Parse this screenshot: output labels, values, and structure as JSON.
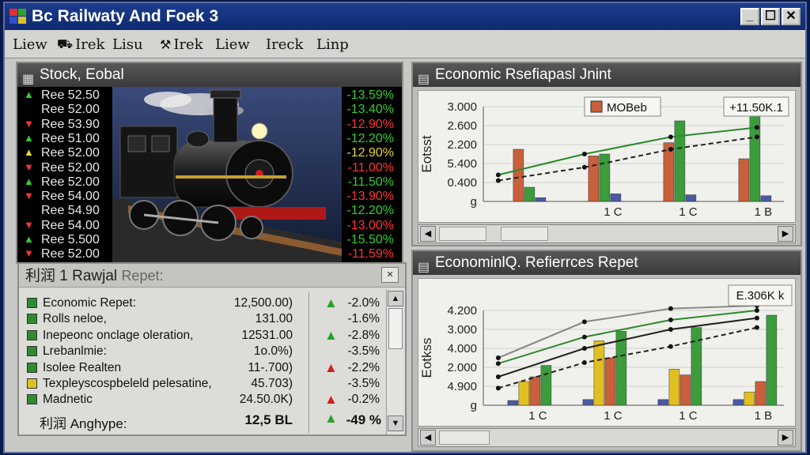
{
  "window": {
    "title": "Bc Railwaty And Foek 3",
    "controls": [
      "_",
      "☐",
      "✕"
    ]
  },
  "menu": [
    {
      "label": "Liew",
      "icon": ""
    },
    {
      "label": "Irek",
      "icon": "⛟"
    },
    {
      "label": "Lisu",
      "icon": ""
    },
    {
      "label": "Irek",
      "icon": "⚒"
    },
    {
      "label": "Liew",
      "icon": ""
    },
    {
      "label": "Ireck",
      "icon": ""
    },
    {
      "label": "Linp",
      "icon": ""
    }
  ],
  "stock_panel": {
    "title": "Stock, Eobal",
    "rows": [
      {
        "label": "Ree 52.50",
        "change": "-13.59%",
        "dir": "up"
      },
      {
        "label": "Ree 52.00",
        "change": "-13.40%",
        "dir": "none"
      },
      {
        "label": "Ree 53.90",
        "change": "-12.90%",
        "dir": "down"
      },
      {
        "label": "Ree 51.00",
        "change": "-12.20%",
        "dir": "up"
      },
      {
        "label": "Ree 52.00",
        "change": "-12.90%",
        "dir": "flat"
      },
      {
        "label": "Ree 52.00",
        "change": "-11.00%",
        "dir": "down"
      },
      {
        "label": "Ree 52.00",
        "change": "-11.50%",
        "dir": "up"
      },
      {
        "label": "Ree 54.00",
        "change": "-13.90%",
        "dir": "down"
      },
      {
        "label": "Ree 54.90",
        "change": "-12.20%",
        "dir": "none"
      },
      {
        "label": "Ree 54.00",
        "change": "-13.00%",
        "dir": "down"
      },
      {
        "label": "Ree 5.500",
        "change": "-15.50%",
        "dir": "up"
      },
      {
        "label": "Ree 52.00",
        "change": "-11.59%",
        "dir": "down"
      }
    ]
  },
  "report_panel": {
    "title": "利润 1 Rawjal",
    "subtitle": "Repet:",
    "close": "×",
    "rows": [
      {
        "name": "Economic Repet:",
        "value": "12,500.00)",
        "dir": "up",
        "pct": "-2.0%",
        "color": "#2e8b2e"
      },
      {
        "name": "Rolls neloe,",
        "value": "131.00",
        "dir": "none",
        "pct": "-1.6%",
        "color": "#2e8b2e"
      },
      {
        "name": "Inepeonc onclage oleration,",
        "value": "12531.00",
        "dir": "up",
        "pct": "-2.8%",
        "color": "#2e8b2e"
      },
      {
        "name": "Lrebanlmie:",
        "value": "1o.0%)",
        "dir": "none",
        "pct": "-3.5%",
        "color": "#2e8b2e"
      },
      {
        "name": "Isolee Realten",
        "value": "11-.700)",
        "dir": "down",
        "pct": "-2.2%",
        "color": "#2e8b2e"
      },
      {
        "name": "Texpleyscospbeleld pelesatine,",
        "value": "45.703)",
        "dir": "none",
        "pct": "-3.5%",
        "color": "#e0c020"
      },
      {
        "name": "Madnetic",
        "value": "24.50.0K)",
        "dir": "down",
        "pct": "-0.2%",
        "color": "#2e8b2e"
      }
    ],
    "total": {
      "label": "利润 Anghype:",
      "value": "12,5 BL",
      "dir": "up",
      "pct": "-49 %"
    }
  },
  "chart_panels": [
    {
      "title": "Economic Rsefiapasl Jnint",
      "legend_label": "MOBeb",
      "legend_color": "#c8603c",
      "badge": "+11.50K.1"
    },
    {
      "title": "EconominlQ. Refierrces Repet",
      "badge": "E.306K k"
    }
  ],
  "chart_data": [
    {
      "type": "bar",
      "ylabel": "Eotsst",
      "y_ticks": [
        "3.000",
        "2.600",
        "2.200",
        "5.400",
        "0.400",
        "g"
      ],
      "categories": [
        "",
        "1 C",
        "1 C",
        "1 B"
      ],
      "series": [
        {
          "name": "MOBeb",
          "color": "#c8603c",
          "values": [
            0.55,
            0.48,
            0.62,
            0.45
          ]
        },
        {
          "color": "#3c9c3c",
          "values": [
            0.15,
            0.5,
            0.85,
            1.0
          ]
        },
        {
          "color": "#4a5aa0",
          "values": [
            0.04,
            0.08,
            0.07,
            0.06
          ]
        }
      ],
      "trend_lines": [
        {
          "color": "#2a8a2a",
          "dash": false,
          "values": [
            0.28,
            0.5,
            0.68,
            0.78
          ]
        },
        {
          "color": "#222222",
          "dash": true,
          "values": [
            0.22,
            0.36,
            0.55,
            0.68
          ]
        }
      ]
    },
    {
      "type": "bar",
      "ylabel": "Eotkss",
      "y_ticks": [
        "4.200",
        "3.000",
        "4.000",
        "2.000",
        "4.900",
        "g"
      ],
      "categories": [
        "1 C",
        "1 C",
        "1 C",
        "1 B"
      ],
      "series": [
        {
          "color": "#4a5aa0",
          "values": [
            0.05,
            0.06,
            0.06,
            0.06
          ]
        },
        {
          "color": "#e0c020",
          "values": [
            0.25,
            0.68,
            0.38,
            0.14
          ]
        },
        {
          "color": "#c8603c",
          "values": [
            0.3,
            0.5,
            0.32,
            0.25
          ]
        },
        {
          "color": "#3c9c3c",
          "values": [
            0.42,
            0.78,
            0.82,
            0.95
          ]
        }
      ],
      "trend_lines": [
        {
          "color": "#888888",
          "dash": false,
          "values": [
            0.5,
            0.88,
            1.02,
            1.05
          ]
        },
        {
          "color": "#2a8a2a",
          "dash": false,
          "values": [
            0.44,
            0.72,
            0.9,
            1.0
          ]
        },
        {
          "color": "#222222",
          "dash": false,
          "values": [
            0.3,
            0.6,
            0.8,
            0.92
          ]
        },
        {
          "color": "#222222",
          "dash": true,
          "values": [
            0.18,
            0.45,
            0.62,
            0.82
          ]
        }
      ]
    }
  ]
}
